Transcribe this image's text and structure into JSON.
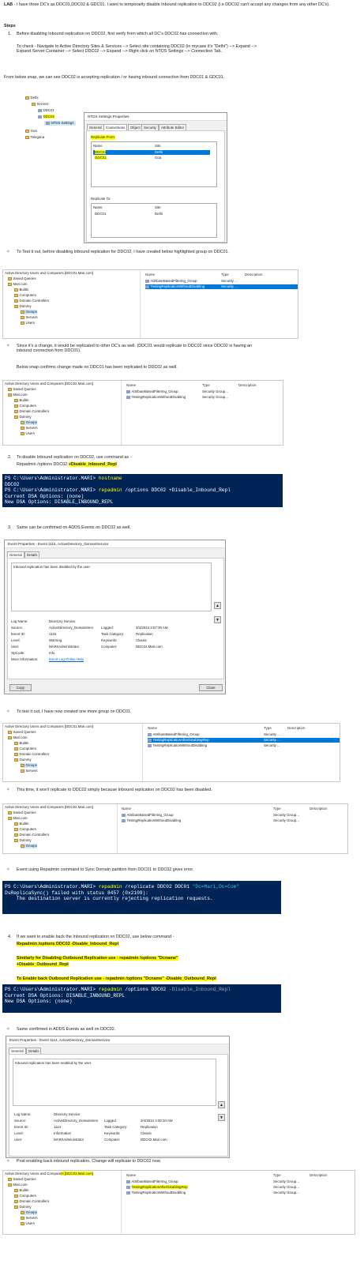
{
  "lab": {
    "label": "LAB",
    "text": " - I have three DC's as DDC01,DDC02 & GDC01. I want to temporarily disable Inbound replication to DDC02 (i.e DDC02 can't accept any changes from any other DC's)."
  },
  "steps_title": "Steps",
  "step1": {
    "num": "1.",
    "l1": "Before disabling Inbound replication on DDC02, first verify from which all DC's DDC02 has connection with.",
    "l2": "To check - Navigate to Active Directory Sites & Services --> Select site containing DDC02 (in mycase it's \"Delhi\") --> Expand --> Expand Server Container --> Select DDC02 --> Expand --> Right click on NTDS Settings --> Connection Tab."
  },
  "snap_text": "From below snap, we can see DDC02 is accepting replication / or having inbound connection from DDC01 & GDC01.",
  "sites": {
    "tree": [
      "Delhi",
      "Servers",
      "DDC01",
      "DDC02",
      "NTDS Settings",
      "Goa",
      "Telegana"
    ],
    "dialog_title": "NTDS Settings Properties",
    "tabs": [
      "General",
      "Connections",
      "Object",
      "Security",
      "Attribute Editor"
    ],
    "from_label": "Replicate From:",
    "to_label": "Replicate To:",
    "col_name": "Name",
    "col_site": "Site",
    "from_rows": [
      [
        "DDC01",
        "Delhi"
      ],
      [
        "GDC01",
        "Goa"
      ]
    ],
    "to_rows": [
      [
        "DDC01",
        "Delhi"
      ]
    ]
  },
  "bullet1": "To Test it out, before disabling Inbound replication for DDC02, I have created below highlighted group on DDC01.",
  "aduc1": {
    "title": "Active Directory Users and Computers [DDC01.Mari.com]",
    "tree": [
      "Saved Queries",
      "Mari.com",
      "Builtin",
      "Computers",
      "Domain Controllers",
      "Dummy",
      "Groups",
      "Servers",
      "Users"
    ],
    "cols": [
      "Name",
      "Type",
      "Description"
    ],
    "rows": [
      [
        "AttributeBasedFiltering_Group",
        "Security ..."
      ],
      [
        "TestingReplicationWithoutDisabling",
        "Security ..."
      ]
    ]
  },
  "bullet2a": "Since it's a change, it would be replicated to other DC's as well. (DDC01 would replicate to DDC02 since DDC02 is having an inbound connection from DDC01).",
  "bullet2b": "Below snap confirms change made on DDC01 has been replicated to DDC02 as well.",
  "aduc2": {
    "title": "Active Directory Users and Computers [DDC02.Mari.com]",
    "tree": [
      "Saved Queries",
      "Mari.com",
      "Builtin",
      "Computers",
      "Domain Controllers",
      "Dummy",
      "Groups",
      "Servers",
      "Users"
    ],
    "cols": [
      "Name",
      "Type",
      "Description"
    ],
    "rows": [
      [
        "AttributeBasedFiltering_Group",
        "Security Group..."
      ],
      [
        "TestingReplicationWithoutDisabling",
        "Security Group..."
      ]
    ]
  },
  "step2": {
    "num": "2.",
    "text": "To disable Inbound replication on DDC02, use command as -",
    "cmd_pre": "Repadmin /options DDC02 ",
    "cmd_hl": "+Disable_Inbound_Repl"
  },
  "term1": {
    "p1": "PS C:\\Users\\Administrator.MARI> ",
    "c1": "hostname",
    "o1": "DDC02",
    "p2": "PS C:\\Users\\Administrator.MARI> ",
    "c2": "repadmin",
    "a2": " /options DDC02 +Disable_Inbound_Repl",
    "o2": "Current DSA Options: (none)",
    "o3": "New DSA Options: DISABLE_INBOUND_REPL"
  },
  "step3": {
    "num": "3.",
    "text": "Same can be confirmed on ADDS Events on DDC02 as well."
  },
  "event1": {
    "title": "Event Properties - Event 1115, ActiveDirectory_DomainService",
    "tabs": [
      "General",
      "Details"
    ],
    "message": "Inbound replication has been disabled by the user.",
    "fields": {
      "log_name_l": "Log Name:",
      "log_name": "Directory Service",
      "source_l": "Source:",
      "source": "ActiveDirectory_DomainServ",
      "logged_l": "Logged:",
      "logged": "3/4/2024 3:57:00 AM",
      "event_id_l": "Event ID:",
      "event_id": "1115",
      "cat_l": "Task Category:",
      "cat": "Replication",
      "level_l": "Level:",
      "level": "Warning",
      "kw_l": "Keywords:",
      "kw": "Classic",
      "user_l": "User:",
      "user": "MARI\\Administrator",
      "comp_l": "Computer:",
      "comp": "DDC02.Mari.com",
      "op_l": "OpCode:",
      "op": "Info",
      "more_l": "More Information:",
      "more": "Event Log Online Help"
    },
    "copy": "Copy",
    "close": "Close"
  },
  "bullet3": "To test it out, I have now created one more group on DDC01.",
  "aduc3": {
    "title": "Active Directory Users and Computers [DDC01.Mari.com]",
    "tree": [
      "Saved Queries",
      "Mari.com",
      "Builtin",
      "Computers",
      "Domain Controllers",
      "Dummy",
      "Groups",
      "Servers"
    ],
    "cols": [
      "Name",
      "Type",
      "Description"
    ],
    "rows": [
      [
        "AttributeBasedFiltering_Group",
        "Security ..."
      ],
      [
        "TestingReplicationAfterDisablingRep",
        "Security ..."
      ],
      [
        "TestingReplicationWithoutDisabling",
        "Security ..."
      ]
    ]
  },
  "bullet4": "This time, it won't replicate to DDC02 simply because Inbound replication on DDC02 has been disabled.",
  "aduc4": {
    "title": "Active Directory Users and Computers [DDC02.Mari.com]",
    "tree": [
      "Saved Queries",
      "Mari.com",
      "Builtin",
      "Computers",
      "Domain Controllers",
      "Dummy",
      "Groups"
    ],
    "cols": [
      "Name",
      "Type",
      "Description"
    ],
    "rows": [
      [
        "AttributeBasedFiltering_Group",
        "Security Group..."
      ],
      [
        "TestingReplicationWithoutDisabling",
        "Security Group..."
      ]
    ]
  },
  "bullet5": "Event using Repadmin command to Sync Domain partition from DDC01 to DDC02 gives error.",
  "term2": {
    "p1": "PS C:\\Users\\Administrator.MARI> ",
    "c1": "repadmin",
    "a1": " /replicate DDC02 DDC01 ",
    "s1": "\"Dc=Mari,Dc=Com\"",
    "o1": "DsReplicaSync() failed with status 8457 (0x2109):",
    "o2": "    The destination server is currently rejecting replication requests."
  },
  "step4": {
    "num": "4.",
    "text": "If we want to enable back the Inbound replication on DDC02, use below command -",
    "cmd": "Repadmin /options DDC02 -Disable_Inbound_Repl",
    "out1": "Similarly for Disabling Outbound Replication use - repadmin /options \"Dcname\"",
    "out2": "+Disable_Outbound_Repl",
    "back": "To Enable back Outbound Replication use - repadmin /options \"Dcname\" -Disable_Outbound_Repl"
  },
  "term3": {
    "p1": "PS C:\\Users\\Administrator.MARI> ",
    "c1": "repadmin",
    "a1": " /options DDC02 ",
    "g1": "-Disable_Inbound_Repl",
    "o1": "Current DSA Options: DISABLE_INBOUND_REPL",
    "o2": "New DSA Options: (none)"
  },
  "bullet6": "Same confirmed in ADDS Events as well on DDC02.",
  "event2": {
    "title": "Event Properties - Event 1114, ActiveDirectory_DomainService",
    "tabs": [
      "General",
      "Details"
    ],
    "message": "Inbound replication has been enabled by the user.",
    "fields": {
      "log_name_l": "Log Name:",
      "log_name": "Directory Service",
      "source_l": "Source:",
      "source": "ActiveDirectory_DomainServ",
      "logged_l": "Logged:",
      "logged": "3/4/2024 4:00:34 AM",
      "event_id_l": "Event ID:",
      "event_id": "1114",
      "cat_l": "Task Category:",
      "cat": "Replication",
      "level_l": "Level:",
      "level": "Information",
      "kw_l": "Keywords:",
      "kw": "Classic",
      "user_l": "User:",
      "user": "MARI\\Administrator",
      "comp_l": "Computer:",
      "comp": "DDC02.Mari.com"
    }
  },
  "bullet7": "Post enabling back inbound replication, Change will replicate to DDC02 now.",
  "aduc5": {
    "title_pre": "Active Directory Users and Compute",
    "title_hl": "rs [DDC02.Mari.com]",
    "tree": [
      "Saved Queries",
      "Mari.com",
      "Builtin",
      "Computers",
      "Domain Controllers",
      "Dummy",
      "Groups",
      "Servers",
      "Users"
    ],
    "cols": [
      "Name",
      "Type",
      "Description"
    ],
    "rows": [
      [
        "AttributeBasedFiltering_Group",
        "Security Group..."
      ],
      [
        "TestingReplicationAfterDisablingRep",
        "Security Group..."
      ],
      [
        "TestingReplicationWithoutDisabling",
        "Security Group..."
      ]
    ]
  }
}
